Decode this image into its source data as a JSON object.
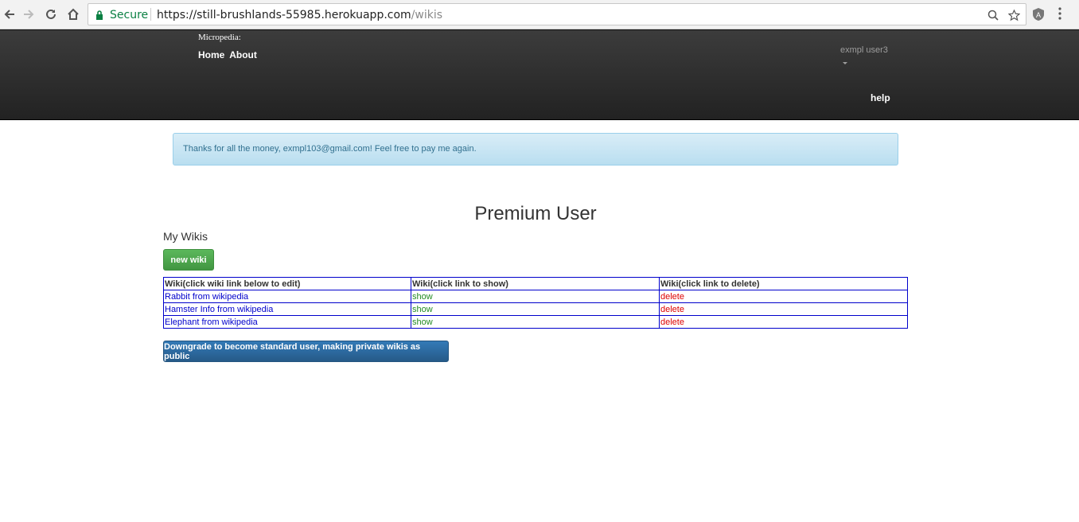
{
  "browser": {
    "secure_label": "Secure",
    "url_host": "https://still-brushlands-55985.herokuapp.com",
    "url_path": "/wikis"
  },
  "navbar": {
    "brand": "Micropedia:",
    "links": [
      "Home",
      "About"
    ],
    "user": "exmpl user3",
    "help": "help"
  },
  "alert": {
    "message": "Thanks for all the money, exmpl103@gmail.com! Feel free to pay me again."
  },
  "main": {
    "title": "Premium User",
    "section_title": "My Wikis",
    "new_wiki_label": "new wiki",
    "downgrade_label": "Downgrade to become standard user, making private wikis as public"
  },
  "table": {
    "headers": [
      "Wiki(click wiki link below to edit)",
      "Wiki(click link to show)",
      "Wiki(click link to delete)"
    ],
    "rows": [
      {
        "title": "Rabbit from wikipedia",
        "show": "show",
        "delete": "delete"
      },
      {
        "title": "Hamster Info from wikipedia",
        "show": "show",
        "delete": "delete"
      },
      {
        "title": "Elephant from wikipedia",
        "show": "show",
        "delete": "delete"
      }
    ]
  },
  "colors": {
    "navbar": "#222222",
    "alert_bg": "#d9edf7",
    "success": "#5cb85c",
    "primary": "#337ab7",
    "table_border": "#0000cc"
  }
}
